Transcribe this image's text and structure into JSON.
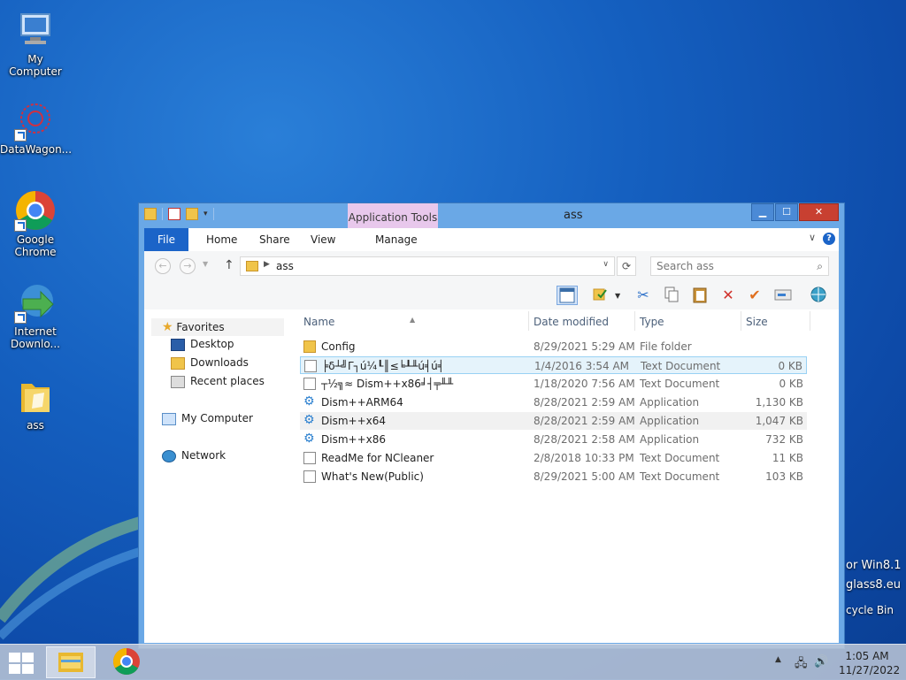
{
  "desktop": {
    "icons": [
      {
        "label": "My Computer"
      },
      {
        "label": "DataWagon..."
      },
      {
        "label": "Google Chrome"
      },
      {
        "label": "Internet Downlo..."
      },
      {
        "label": "ass"
      }
    ],
    "right_texts": [
      "or Win8.1",
      "glass8.eu",
      "cycle Bin"
    ]
  },
  "window": {
    "title": "ass",
    "context_tab": "Application Tools",
    "ribbon_tabs": [
      "File",
      "Home",
      "Share",
      "View",
      "Manage"
    ],
    "address": {
      "path": "ass"
    },
    "search": {
      "placeholder": "Search ass"
    }
  },
  "nav_pane": {
    "favorites": "Favorites",
    "favorite_items": [
      "Desktop",
      "Downloads",
      "Recent places"
    ],
    "my_computer": "My Computer",
    "network": "Network"
  },
  "file_list": {
    "columns": [
      "Name",
      "Date modified",
      "Type",
      "Size"
    ],
    "rows": [
      {
        "name": "Config",
        "date": "8/29/2021 5:29 AM",
        "type": "File folder",
        "size": "",
        "icon": "folder-icon"
      },
      {
        "name": "╞δ┴╝Γ┐ú¼┖║≤╘┸╨ú╡ú╡",
        "date": "1/4/2016 3:54 AM",
        "type": "Text Document",
        "size": "0 KB",
        "icon": "text-file-icon"
      },
      {
        "name": "┬½╗≈ Dism++x86╛┤╤╨╨",
        "date": "1/18/2020 7:56 AM",
        "type": "Text Document",
        "size": "0 KB",
        "icon": "text-file-icon"
      },
      {
        "name": "Dism++ARM64",
        "date": "8/28/2021 2:59 AM",
        "type": "Application",
        "size": "1,130 KB",
        "icon": "app-gear-icon"
      },
      {
        "name": "Dism++x64",
        "date": "8/28/2021 2:59 AM",
        "type": "Application",
        "size": "1,047 KB",
        "icon": "app-gear-icon"
      },
      {
        "name": "Dism++x86",
        "date": "8/28/2021 2:58 AM",
        "type": "Application",
        "size": "732 KB",
        "icon": "app-gear-icon"
      },
      {
        "name": "ReadMe for NCleaner",
        "date": "2/8/2018 10:33 PM",
        "type": "Text Document",
        "size": "11 KB",
        "icon": "text-file-icon"
      },
      {
        "name": "What's New(Public)",
        "date": "8/29/2021 5:00 AM",
        "type": "Text Document",
        "size": "103 KB",
        "icon": "text-file-icon"
      }
    ]
  },
  "taskbar": {
    "time": "1:05 AM",
    "date": "11/27/2022"
  }
}
